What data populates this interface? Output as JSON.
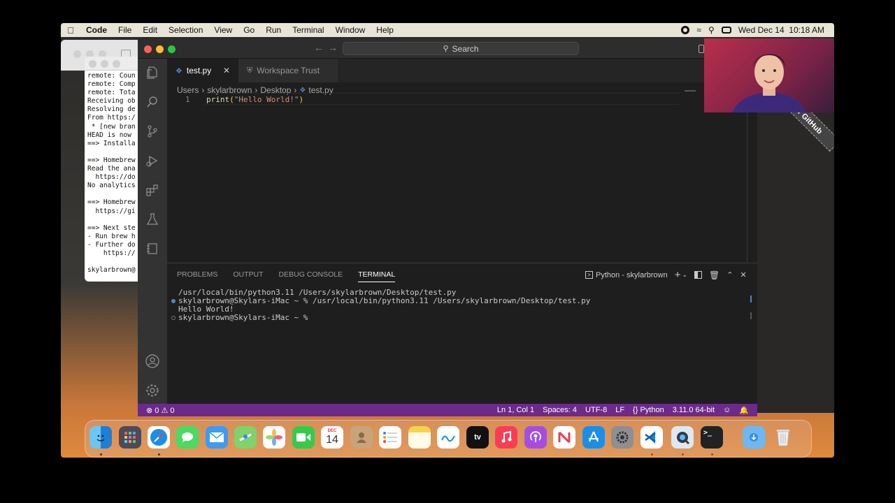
{
  "menubar": {
    "app": "Code",
    "items": [
      "File",
      "Edit",
      "Selection",
      "View",
      "Go",
      "Run",
      "Terminal",
      "Window",
      "Help"
    ],
    "datetime": "Wed Dec 14  10:18 AM"
  },
  "terminal_bg": {
    "lines": "remote: Coun\nremote: Comp\nremote: Tota\nReceiving ob\nResolving de\nFrom https:/\n * [new bran\nHEAD is now\n==> Installa\n\n==> Homebrew\nRead the ana\n  https://do\nNo analytics\n\n==> Homebrew\n  https://gi\n\n==> Next ste\n- Run brew h\n- Further do\n    https://\n\nskylarbrown@"
  },
  "vscode": {
    "search_label": "Search",
    "tabs": [
      {
        "label": "test.py",
        "active": true
      },
      {
        "label": "Workspace Trust",
        "active": false
      }
    ],
    "breadcrumb": [
      "Users",
      "skylarbrown",
      "Desktop",
      "test.py"
    ],
    "editor": {
      "line_number": "1",
      "code_func": "print",
      "code_open": "(",
      "code_string": "\"Hello World!\"",
      "code_close": ")"
    },
    "panel": {
      "tabs": [
        "PROBLEMS",
        "OUTPUT",
        "DEBUG CONSOLE",
        "TERMINAL"
      ],
      "active_tab": "TERMINAL",
      "terminal_name": "Python - skylarbrown",
      "lines": [
        "/usr/local/bin/python3.11 /Users/skylarbrown/Desktop/test.py",
        "skylarbrown@Skylars-iMac ~ % /usr/local/bin/python3.11 /Users/skylarbrown/Desktop/test.py",
        "Hello World!",
        "skylarbrown@Skylars-iMac ~ % "
      ]
    },
    "status": {
      "errors": "0",
      "warnings": "0",
      "position": "Ln 1, Col 1",
      "spaces": "Spaces: 4",
      "encoding": "UTF-8",
      "eol": "LF",
      "language": "Python",
      "interpreter": "3.11.0 64-bit"
    }
  },
  "ribbon_text": "r GitHub",
  "dock": {
    "calendar_month": "DEC",
    "calendar_day": "14",
    "tv_label": "tv"
  },
  "colors": {
    "status_bar": "#6c2a8a",
    "editor_bg": "#1e1e1e",
    "func": "#dcdcaa",
    "string": "#ce9178"
  }
}
